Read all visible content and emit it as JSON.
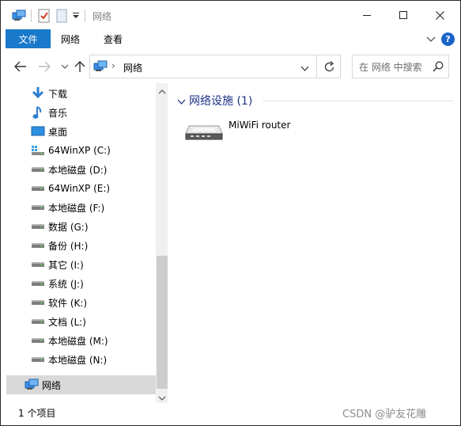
{
  "window": {
    "title": "网络",
    "controls": {
      "minimize": "minimize",
      "maximize": "maximize",
      "close": "close"
    }
  },
  "ribbon": {
    "tabs": [
      {
        "label": "文件",
        "active": true
      },
      {
        "label": "网络",
        "active": false
      },
      {
        "label": "查看",
        "active": false
      }
    ],
    "help_label": "?"
  },
  "address": {
    "path": "网络",
    "separator": "›"
  },
  "search": {
    "placeholder": "在 网络 中搜索"
  },
  "nav": {
    "items": [
      {
        "label": "下载",
        "icon": "download-icon"
      },
      {
        "label": "音乐",
        "icon": "music-icon"
      },
      {
        "label": "桌面",
        "icon": "desktop-icon"
      },
      {
        "label": "64WinXP  (C:)",
        "icon": "system-drive-icon"
      },
      {
        "label": "本地磁盘 (D:)",
        "icon": "drive-icon"
      },
      {
        "label": "64WinXP  (E:)",
        "icon": "drive-icon"
      },
      {
        "label": "本地磁盘 (F:)",
        "icon": "drive-icon"
      },
      {
        "label": "数据 (G:)",
        "icon": "drive-icon"
      },
      {
        "label": "备份 (H:)",
        "icon": "drive-icon"
      },
      {
        "label": "其它 (I:)",
        "icon": "drive-icon"
      },
      {
        "label": "系统 (J:)",
        "icon": "drive-icon"
      },
      {
        "label": "软件 (K:)",
        "icon": "drive-icon"
      },
      {
        "label": "文档 (L:)",
        "icon": "drive-icon"
      },
      {
        "label": "本地磁盘 (M:)",
        "icon": "drive-icon"
      },
      {
        "label": "本地磁盘 (N:)",
        "icon": "drive-icon"
      },
      {
        "label": "网络",
        "icon": "network-icon",
        "selected": true
      }
    ]
  },
  "content": {
    "group_title": "网络设施 (1)",
    "items": [
      {
        "label": "MiWiFi router",
        "icon": "router-icon"
      }
    ]
  },
  "status": {
    "item_count": "1 个项目"
  },
  "watermark": "CSDN @驴友花雕",
  "colors": {
    "accent": "#1979ca",
    "group_title": "#1e3287",
    "selection": "#d9d9d9"
  }
}
